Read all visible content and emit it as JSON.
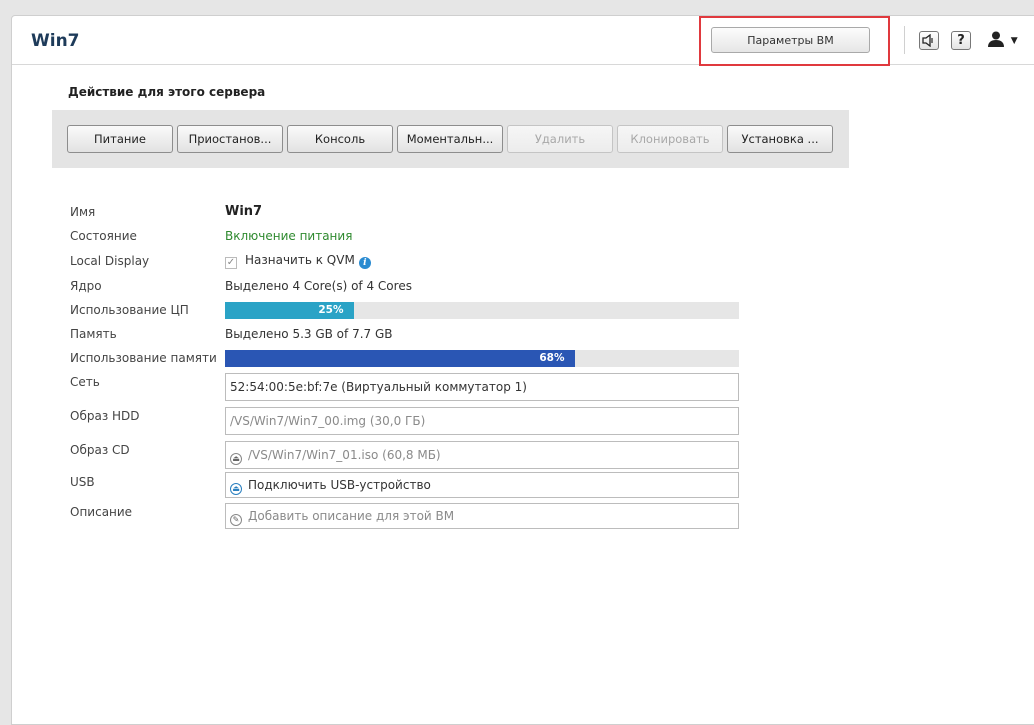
{
  "header": {
    "title": "Win7",
    "vm_settings_label": "Параметры ВМ"
  },
  "toolbar": {
    "title": "Действие для этого сервера",
    "buttons": [
      {
        "label": "Питание",
        "enabled": true
      },
      {
        "label": "Приостанов...",
        "enabled": true
      },
      {
        "label": "Консоль",
        "enabled": true
      },
      {
        "label": "Моментальн...",
        "enabled": true
      },
      {
        "label": "Удалить",
        "enabled": false
      },
      {
        "label": "Клонировать",
        "enabled": false
      },
      {
        "label": "Установка ...",
        "enabled": true
      }
    ]
  },
  "details": {
    "name": {
      "label": "Имя",
      "value": "Win7"
    },
    "state": {
      "label": "Состояние",
      "value": "Включение питания",
      "color": "#2f8a2f"
    },
    "local_display": {
      "label": "Local Display",
      "value": "Назначить к QVM",
      "checked": true
    },
    "core": {
      "label": "Ядро",
      "value": "Выделено 4 Core(s) of 4 Cores"
    },
    "cpu_usage": {
      "label": "Использование ЦП",
      "value_text": "25%",
      "percent": 25,
      "color": "#2aa3c6"
    },
    "memory": {
      "label": "Память",
      "value": "Выделено 5.3 GB of 7.7 GB"
    },
    "memory_usage": {
      "label": "Использование памяти",
      "value_text": "68%",
      "percent": 68,
      "color": "#2a56b4"
    },
    "network": {
      "label": "Сеть",
      "value": "52:54:00:5e:bf:7e (Виртуальный коммутатор 1)"
    },
    "hdd": {
      "label": "Образ HDD",
      "value": "/VS/Win7/Win7_00.img (30,0 ГБ)"
    },
    "cd": {
      "label": "Образ CD",
      "value": "/VS/Win7/Win7_01.iso (60,8 МБ)"
    },
    "usb": {
      "label": "USB",
      "value": "Подключить USB-устройство"
    },
    "description": {
      "label": "Описание",
      "placeholder": "Добавить описание для этой ВМ"
    }
  },
  "icons": {
    "speaker": "speaker-icon",
    "help": "help-icon",
    "user": "user-icon",
    "info": "info-icon",
    "eject": "eject-icon",
    "pencil": "pencil-icon"
  }
}
